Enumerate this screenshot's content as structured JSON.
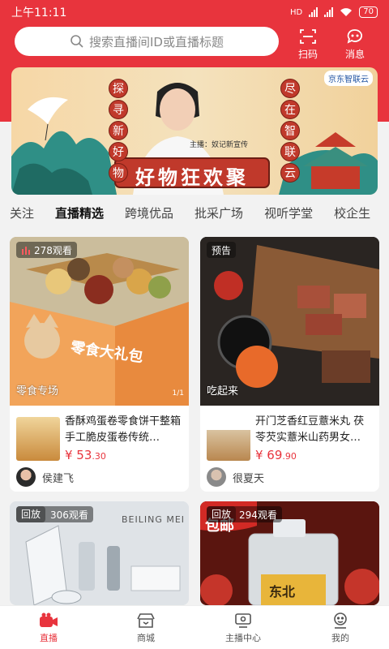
{
  "status": {
    "time": "上午11:11",
    "battery": "70",
    "net": "HD"
  },
  "search": {
    "placeholder": "搜索直播间ID或直播标题"
  },
  "header": {
    "scan_label": "扫码",
    "message_label": "消息"
  },
  "banner": {
    "left_chars": [
      "探",
      "寻",
      "新",
      "好",
      "物"
    ],
    "right_chars": [
      "尽",
      "在",
      "智",
      "联",
      "云"
    ],
    "headline": "好物狂欢聚",
    "host_caption": "主播：奴记新宣传",
    "brand": "京东智联云"
  },
  "tabs": [
    "关注",
    "直播精选",
    "跨境优品",
    "批采广场",
    "视听学堂",
    "校企生"
  ],
  "cards": [
    {
      "badge": "278观看",
      "caption": "零食专场",
      "pager": "1/1",
      "title": "香酥鸡蛋卷零食饼干整箱手工脆皮蛋卷传统…",
      "price_int": "¥ 53",
      "price_dec": ".30",
      "author": "侯建飞",
      "box_text": "零食大礼包"
    },
    {
      "badge": "预告",
      "caption": "吃起来",
      "title": "开门芝香红豆薏米丸 茯苓芡实薏米山药男女…",
      "price_int": "¥ 69",
      "price_dec": ".90",
      "author": "很夏天"
    },
    {
      "badge": "回放",
      "views": "306观看",
      "brand_text": "BEILING MEI"
    },
    {
      "badge": "回放",
      "views": "294观看",
      "corner": "包邮",
      "jar_text": "东北"
    }
  ],
  "nav": [
    {
      "label": "直播",
      "icon": "live-camera-icon"
    },
    {
      "label": "商城",
      "icon": "shop-icon"
    },
    {
      "label": "主播中心",
      "icon": "anchor-center-icon"
    },
    {
      "label": "我的",
      "icon": "profile-icon"
    }
  ],
  "colors": {
    "accent": "#e8343d",
    "price": "#e8343d"
  }
}
